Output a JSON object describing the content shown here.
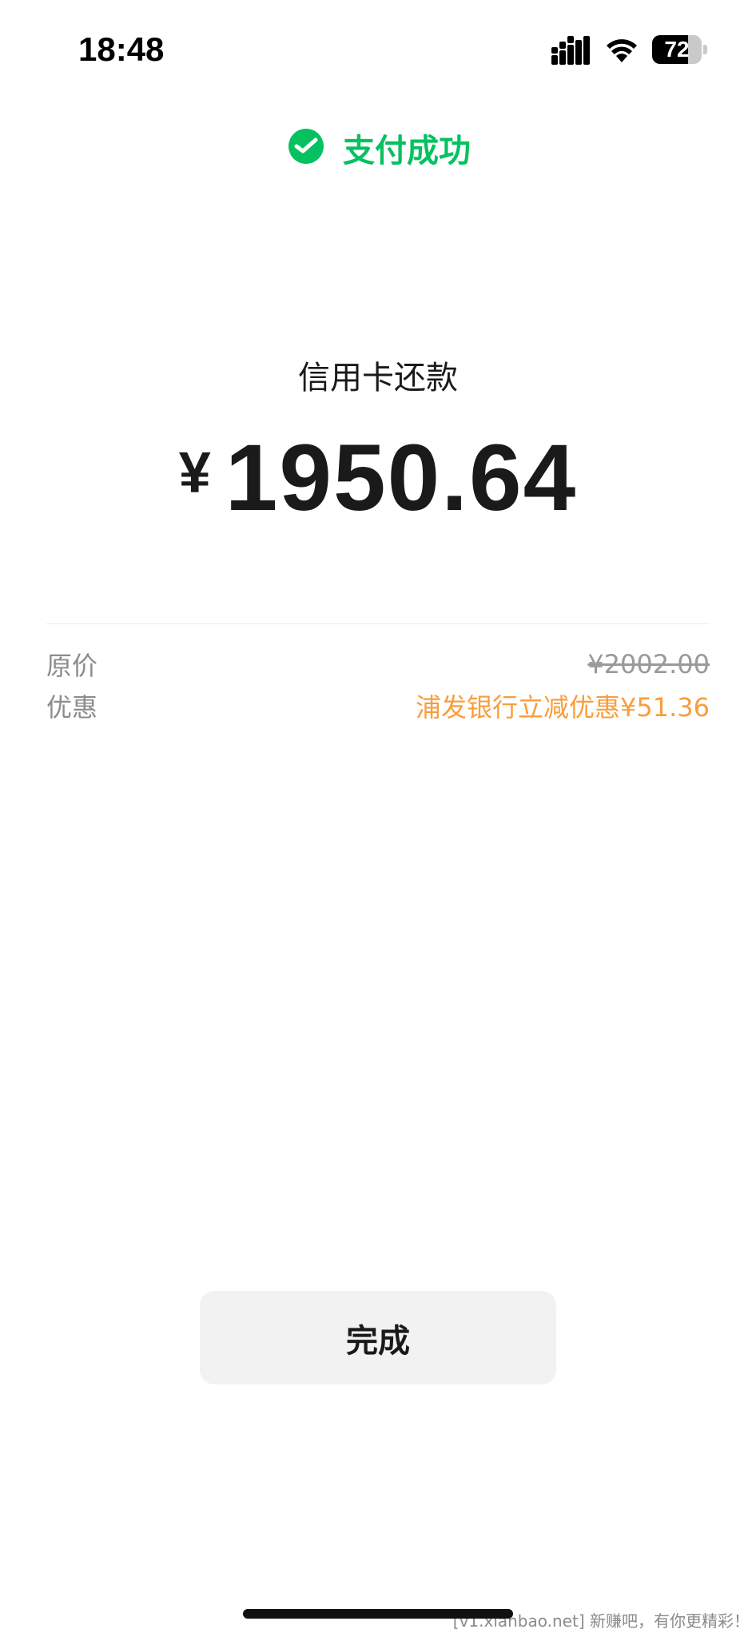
{
  "status_bar": {
    "time": "18:48",
    "battery_level": 72,
    "battery_text": "72"
  },
  "header": {
    "title": "支付成功",
    "accent_color": "#07c160"
  },
  "payment": {
    "merchant": "信用卡还款",
    "currency_symbol": "¥",
    "amount": "1950.64"
  },
  "details": [
    {
      "label": "原价",
      "value": "¥2002.00",
      "style": "strikethrough"
    },
    {
      "label": "优惠",
      "value": "浦发银行立减优惠¥51.36",
      "style": "discount",
      "color": "#fa9d3b"
    }
  ],
  "actions": {
    "done_label": "完成"
  },
  "watermark": "[v1.xianbao.net] 新赚吧，有你更精彩！",
  "icons": {
    "success": "wechat-pay-icon",
    "signal": "signal-icon",
    "wifi": "wifi-icon",
    "battery": "battery-icon"
  }
}
